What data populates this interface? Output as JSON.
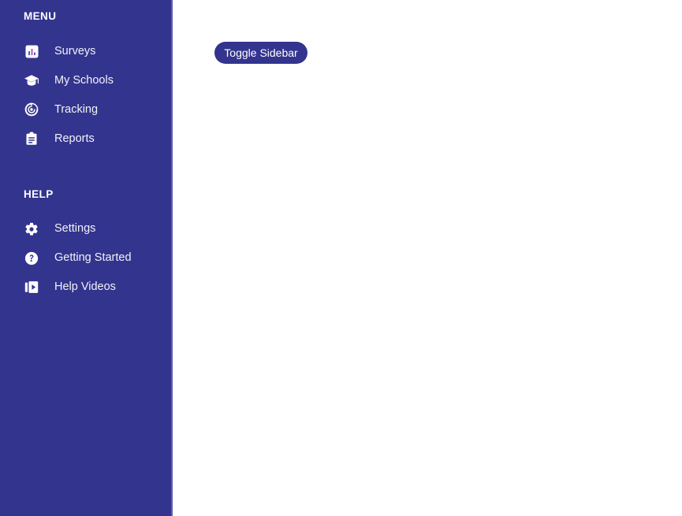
{
  "colors": {
    "sidebar_bg": "#33348e",
    "sidebar_border": "#5b5fb0",
    "sidebar_text": "#f2f2f7",
    "main_bg": "#ffffff",
    "button_bg": "#33348e",
    "button_text": "#ffffff",
    "icon_fill": "#ffffff",
    "icon_accent_magenta": "#c44fc4",
    "icon_accent_blue": "#4f5fd0"
  },
  "sidebar": {
    "sections": [
      {
        "title": "MENU",
        "items": [
          {
            "label": "Surveys",
            "icon": "survey-chart-icon"
          },
          {
            "label": "My Schools",
            "icon": "graduation-cap-icon"
          },
          {
            "label": "Tracking",
            "icon": "radar-target-icon"
          },
          {
            "label": "Reports",
            "icon": "clipboard-icon"
          }
        ]
      },
      {
        "title": "HELP",
        "items": [
          {
            "label": "Settings",
            "icon": "gear-icon"
          },
          {
            "label": "Getting Started",
            "icon": "question-circle-icon"
          },
          {
            "label": "Help Videos",
            "icon": "video-play-icon"
          }
        ]
      }
    ]
  },
  "main": {
    "toggle_sidebar_label": "Toggle Sidebar"
  }
}
